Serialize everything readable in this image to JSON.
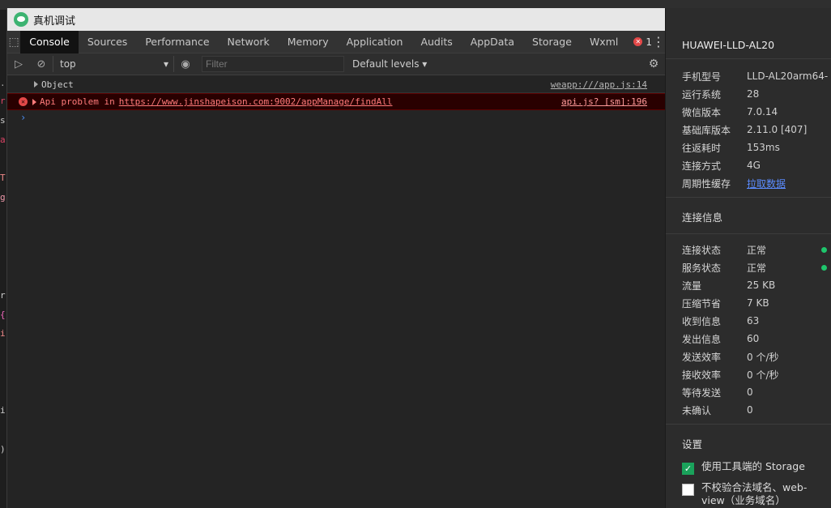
{
  "window": {
    "title": "真机调试"
  },
  "tabs": [
    {
      "label": "Console",
      "active": true
    },
    {
      "label": "Sources"
    },
    {
      "label": "Performance"
    },
    {
      "label": "Network"
    },
    {
      "label": "Memory"
    },
    {
      "label": "Application"
    },
    {
      "label": "Audits"
    },
    {
      "label": "AppData"
    },
    {
      "label": "Storage"
    },
    {
      "label": "Wxml"
    }
  ],
  "error_count": "1",
  "toolbar": {
    "context": "top",
    "filter_placeholder": "Filter",
    "levels": "Default levels"
  },
  "console": {
    "rows": [
      {
        "type": "log",
        "text": "Object",
        "source": "weapp:///app.js:14"
      },
      {
        "type": "error",
        "prefix": "Api problem in",
        "url": "https://www.jinshapeison.com:9002/appManage/findAll",
        "source": "api.js? [sm]:196"
      }
    ],
    "prompt": "›"
  },
  "device": {
    "name": "HUAWEI-LLD-AL20",
    "info": [
      {
        "k": "手机型号",
        "v": "LLD-AL20arm64-..."
      },
      {
        "k": "运行系统",
        "v": "28"
      },
      {
        "k": "微信版本",
        "v": "7.0.14"
      },
      {
        "k": "基础库版本",
        "v": "2.11.0 [407]"
      },
      {
        "k": "往返耗时",
        "v": "153ms"
      },
      {
        "k": "连接方式",
        "v": "4G"
      },
      {
        "k": "周期性缓存",
        "v": "拉取数据"
      }
    ]
  },
  "connection": {
    "title": "连接信息",
    "items": [
      {
        "k": "连接状态",
        "v": "正常"
      },
      {
        "k": "服务状态",
        "v": "正常"
      },
      {
        "k": "流量",
        "v": "25 KB"
      },
      {
        "k": "压缩节省",
        "v": "7 KB"
      },
      {
        "k": "收到信息",
        "v": "63"
      },
      {
        "k": "发出信息",
        "v": "60"
      },
      {
        "k": "发送效率",
        "v": "0 个/秒"
      },
      {
        "k": "接收效率",
        "v": "0 个/秒"
      },
      {
        "k": "等待发送",
        "v": "0"
      },
      {
        "k": "未确认",
        "v": "0"
      }
    ]
  },
  "settings": {
    "title": "设置",
    "use_storage": "使用工具端的 Storage",
    "skip_domain": "不校验合法域名、web-view（业务域名）"
  },
  "colors": {
    "status_ok": "#1ec66c",
    "error_text": "#ff7b7b",
    "link": "#5b8cff"
  }
}
